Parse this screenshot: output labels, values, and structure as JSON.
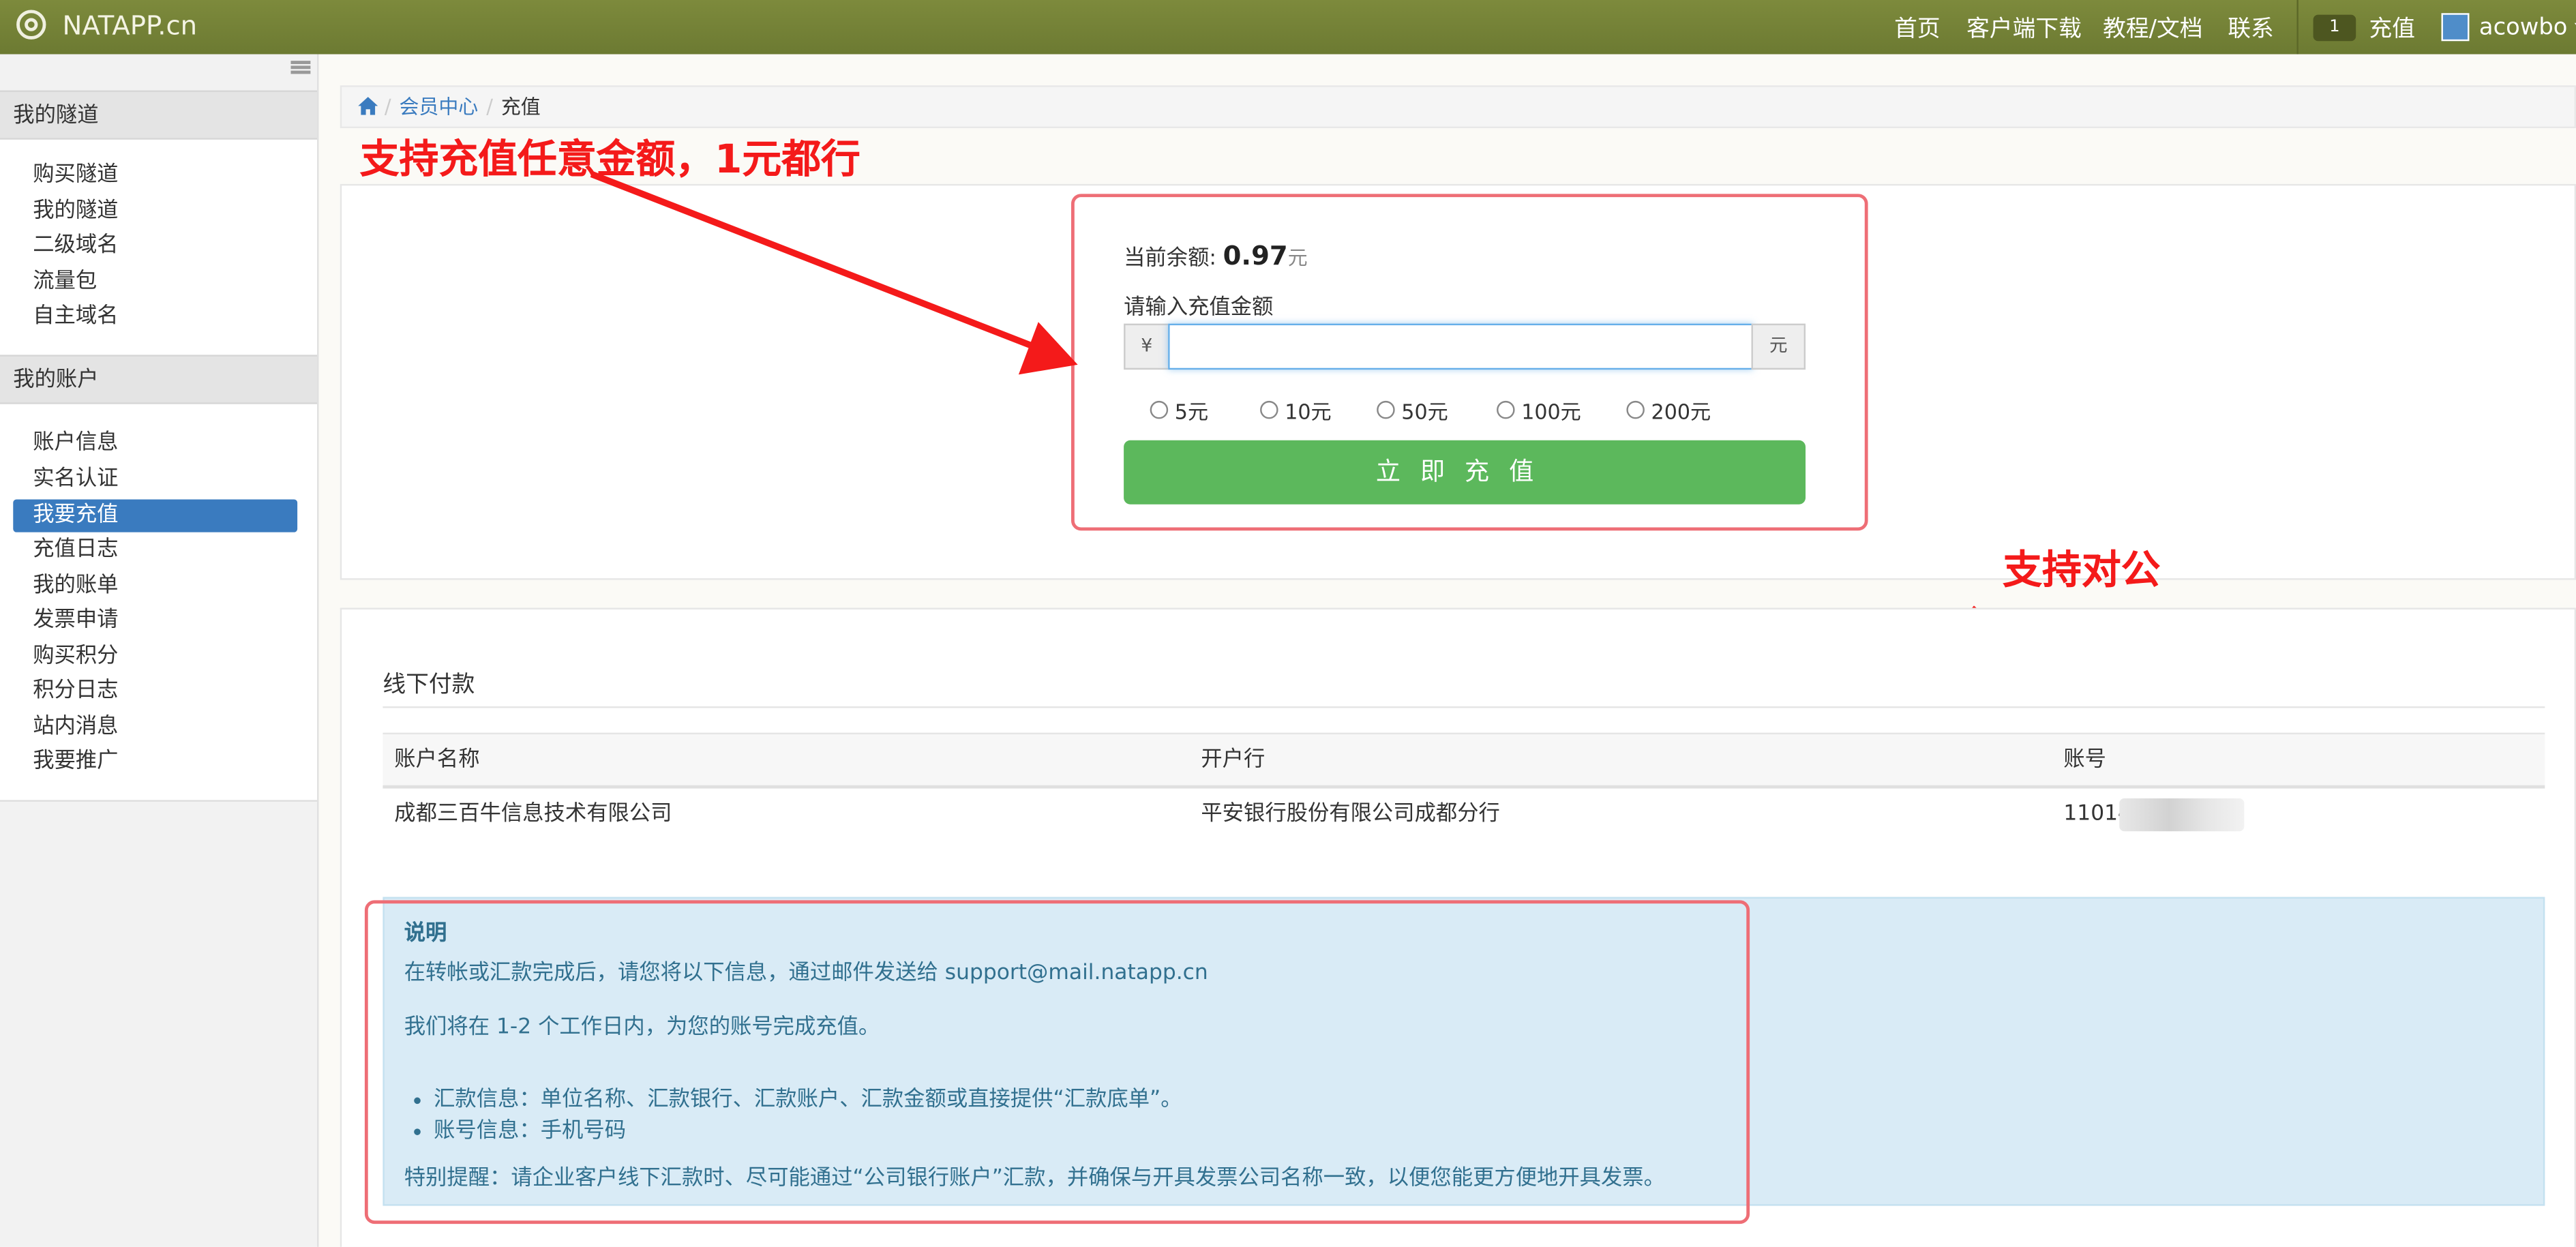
{
  "topbar": {
    "brand": "NATAPP.cn",
    "nav": [
      "首页",
      "客户端下载",
      "教程/文档",
      "联系"
    ],
    "message_count": "1",
    "recharge_label": "充值",
    "username": "acowbo"
  },
  "sidebar": {
    "groups": [
      {
        "title": "我的隧道",
        "items": [
          "购买隧道",
          "我的隧道",
          "二级域名",
          "流量包",
          "自主域名"
        ]
      },
      {
        "title": "我的账户",
        "items": [
          "账户信息",
          "实名认证",
          "我要充值",
          "充值日志",
          "我的账单",
          "发票申请",
          "购买积分",
          "积分日志",
          "站内消息",
          "我要推广"
        ]
      }
    ],
    "active_item": "我要充值"
  },
  "breadcrumb": {
    "parent": "会员中心",
    "current": "充值"
  },
  "recharge": {
    "balance_label": "当前余额:",
    "balance_value": "0.97",
    "balance_unit": "元",
    "amount_label": "请输入充值金额",
    "currency_symbol": "¥",
    "amount_value": "",
    "unit_suffix": "元",
    "quick_amounts": [
      "5元",
      "10元",
      "50元",
      "100元",
      "200元"
    ],
    "submit_label": "立即充值"
  },
  "annotations": {
    "any_amount": "支持充值任意金额，1元都行",
    "corporate": "支持对公"
  },
  "offline": {
    "title": "线下付款",
    "columns": [
      "账户名称",
      "开户行",
      "账号"
    ],
    "rows": [
      [
        "成都三百牛信息技术有限公司",
        "平安银行股份有限公司成都分行",
        "11014"
      ]
    ]
  },
  "notice": {
    "title": "说明",
    "line1": "在转帐或汇款完成后，请您将以下信息，通过邮件发送给 support@mail.natapp.cn",
    "line2": "我们将在 1-2 个工作日内，为您的账号完成充值。",
    "bullets": [
      "汇款信息：单位名称、汇款银行、汇款账户、汇款金额或直接提供“汇款底单”。",
      "账号信息：手机号码"
    ],
    "reminder": "特别提醒：请企业客户线下汇款时、尽可能通过“公司银行账户”汇款，并确保与开具发票公司名称一致，以便您能更方便地开具发票。"
  },
  "colors": {
    "topbar": "#76843a",
    "active": "#3a7bbf",
    "button": "#5cb85c",
    "annotation": "#f41a1a",
    "notice_bg": "#d9ebf6"
  }
}
